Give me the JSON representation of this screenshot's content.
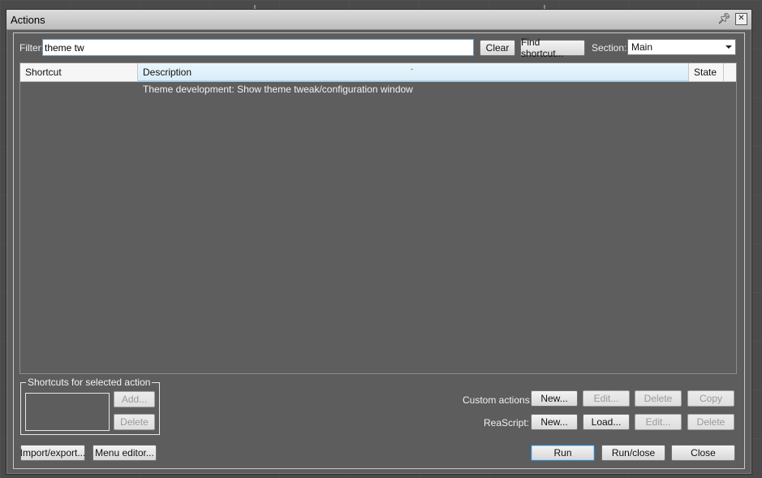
{
  "window": {
    "title": "Actions"
  },
  "filter": {
    "label": "Filter:",
    "value": "theme tw"
  },
  "buttons": {
    "clear": "Clear",
    "find_shortcut": "Find shortcut...",
    "add": "Add...",
    "delete_shortcut": "Delete",
    "import_export": "Import/export...",
    "menu_editor": "Menu editor...",
    "run": "Run",
    "run_close": "Run/close",
    "close": "Close"
  },
  "section": {
    "label": "Section:",
    "value": "Main"
  },
  "list": {
    "columns": [
      "Shortcut",
      "Description",
      "State"
    ],
    "rows": [
      {
        "shortcut": "",
        "description": "Theme development: Show theme tweak/configuration window",
        "state": ""
      }
    ]
  },
  "shortcuts_group": {
    "title": "Shortcuts for selected action"
  },
  "custom_actions": {
    "label": "Custom actions:",
    "new": "New...",
    "edit": "Edit...",
    "delete": "Delete",
    "copy": "Copy"
  },
  "reascript": {
    "label": "ReaScript:",
    "new": "New...",
    "load": "Load...",
    "edit": "Edit...",
    "delete": "Delete"
  },
  "icons": {
    "pin": "pin-icon",
    "close": "close-icon",
    "dropdown": "chevron-down-icon",
    "sort": "sort-ascending-icon"
  }
}
